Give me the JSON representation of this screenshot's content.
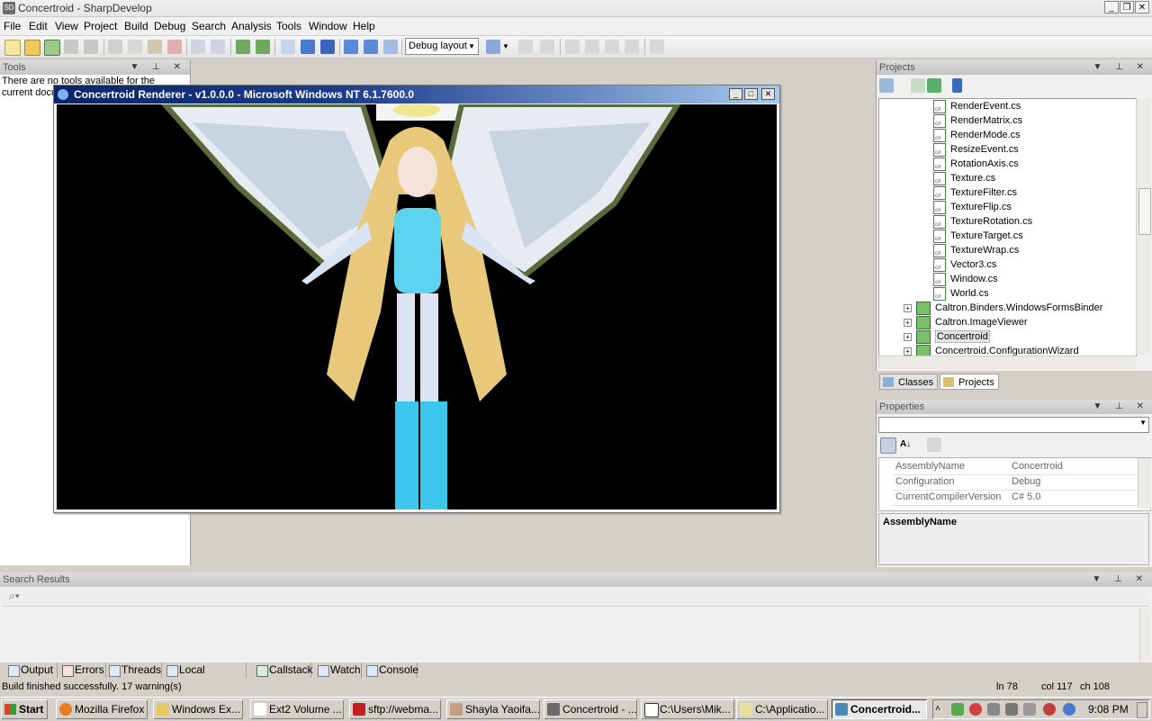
{
  "app": {
    "title": "Concertroid - SharpDevelop",
    "icon_label": "SD"
  },
  "menu": [
    "File",
    "Edit",
    "View",
    "Project",
    "Build",
    "Debug",
    "Search",
    "Analysis",
    "Tools",
    "Window",
    "Help"
  ],
  "toolbar": {
    "layout_select": "Debug layout"
  },
  "tools_panel": {
    "title": "Tools",
    "message": "There are no tools available for the current document."
  },
  "renderer": {
    "title": "Concertroid Renderer - v1.0.0.0 - Microsoft Windows NT 6.1.7600.0"
  },
  "projects_panel": {
    "title": "Projects",
    "files": [
      "RenderEvent.cs",
      "RenderMatrix.cs",
      "RenderMode.cs",
      "ResizeEvent.cs",
      "RotationAxis.cs",
      "Texture.cs",
      "TextureFilter.cs",
      "TextureFlip.cs",
      "TextureRotation.cs",
      "TextureTarget.cs",
      "TextureWrap.cs",
      "Vector3.cs",
      "Window.cs",
      "World.cs"
    ],
    "projects": [
      "Caltron.Binders.WindowsFormsBinder",
      "Caltron.ImageViewer",
      "Concertroid",
      "Concertroid.ConfigurationWizard"
    ],
    "selected_project": "Concertroid",
    "tabs": [
      "Classes",
      "Projects"
    ]
  },
  "properties_panel": {
    "title": "Properties",
    "rows": [
      {
        "key": "AssemblyName",
        "value": "Concertroid"
      },
      {
        "key": "Configuration",
        "value": "Debug"
      },
      {
        "key": "CurrentCompilerVersion",
        "value": "C# 5.0"
      }
    ],
    "description": "AssemblyName"
  },
  "search_panel": {
    "title": "Search Results"
  },
  "bottom_tabs": [
    "Output",
    "Errors",
    "Threads",
    "Local variables",
    "Callstack",
    "Watch",
    "Console"
  ],
  "status": {
    "message": "Build finished successfully. 17 warning(s)",
    "line": "ln 78",
    "col": "col 117",
    "ch": "ch 108"
  },
  "taskbar": {
    "start": "Start",
    "items": [
      "Mozilla Firefox",
      "Windows Ex...",
      "Ext2 Volume ...",
      "sftp://webma...",
      "Shayla Yaoifa...",
      "Concertroid - ...",
      "C:\\Users\\Mik...",
      "C:\\Applicatio...",
      "Concertroid..."
    ],
    "active_index": 8,
    "clock": "9:08 PM"
  }
}
